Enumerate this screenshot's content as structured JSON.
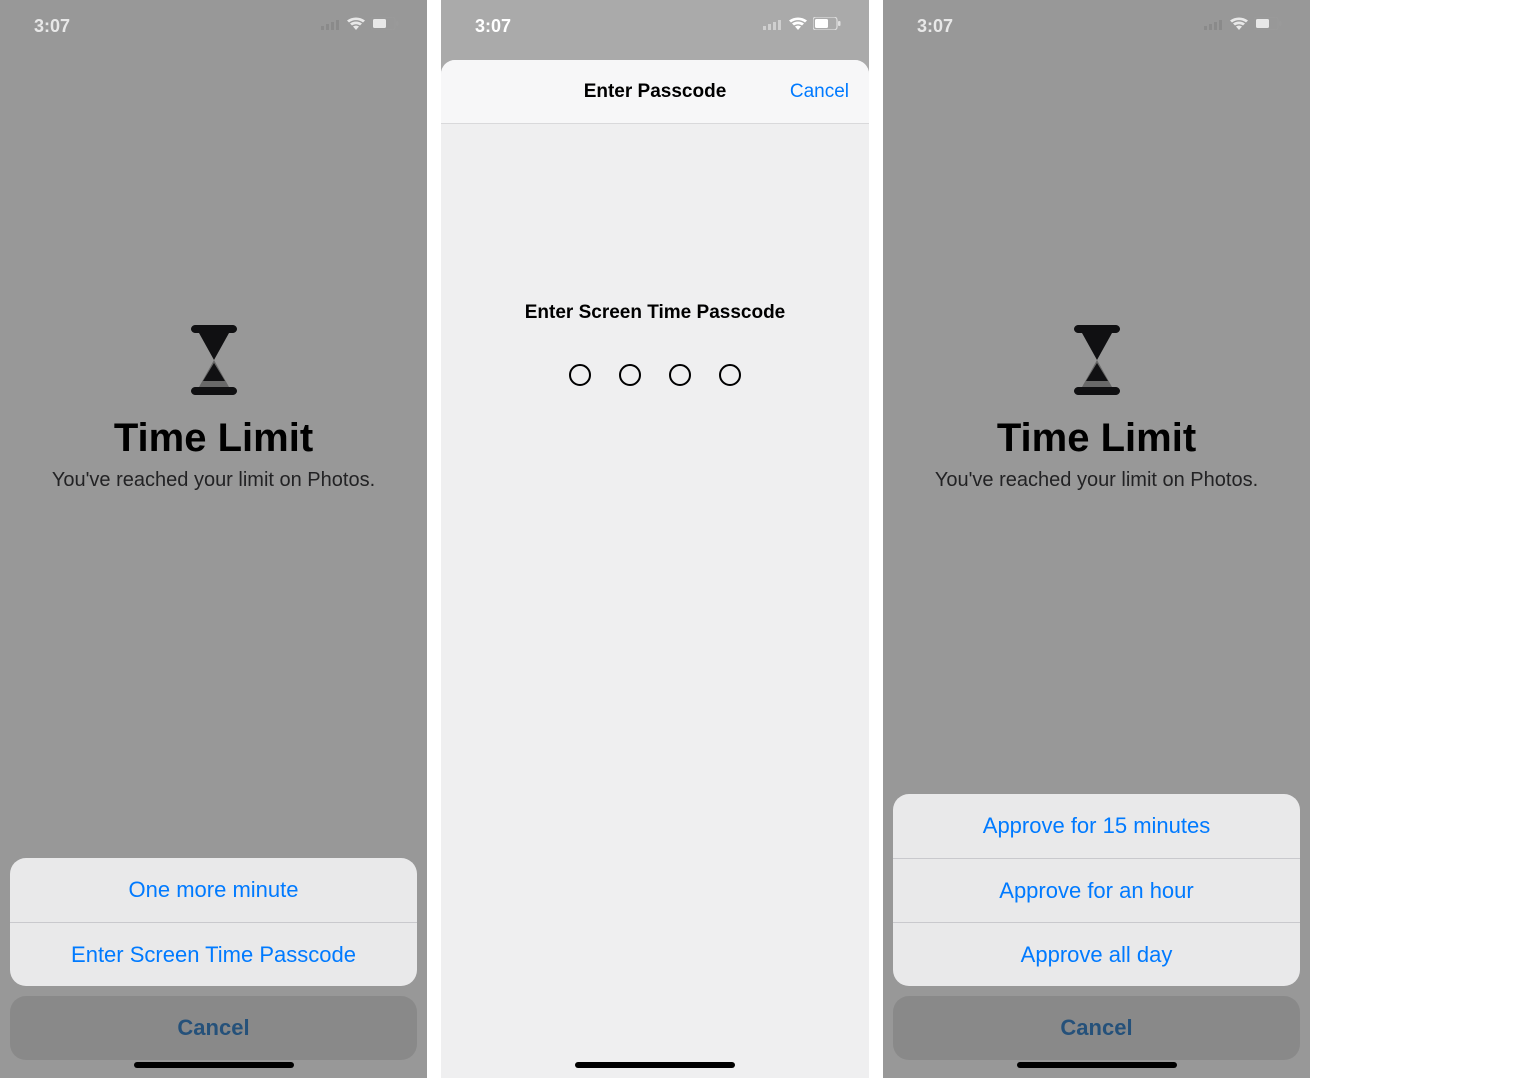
{
  "status": {
    "time": "3:07"
  },
  "time_limit": {
    "title": "Time Limit",
    "subtitle": "You've reached your limit on Photos."
  },
  "left_sheet": {
    "options": [
      "One more minute",
      "Enter Screen Time Passcode"
    ],
    "cancel": "Cancel"
  },
  "middle": {
    "header_title": "Enter Passcode",
    "header_cancel": "Cancel",
    "prompt": "Enter Screen Time Passcode",
    "passcode_length": 4
  },
  "right_sheet": {
    "options": [
      "Approve for 15 minutes",
      "Approve for an hour",
      "Approve all day"
    ],
    "cancel": "Cancel"
  }
}
